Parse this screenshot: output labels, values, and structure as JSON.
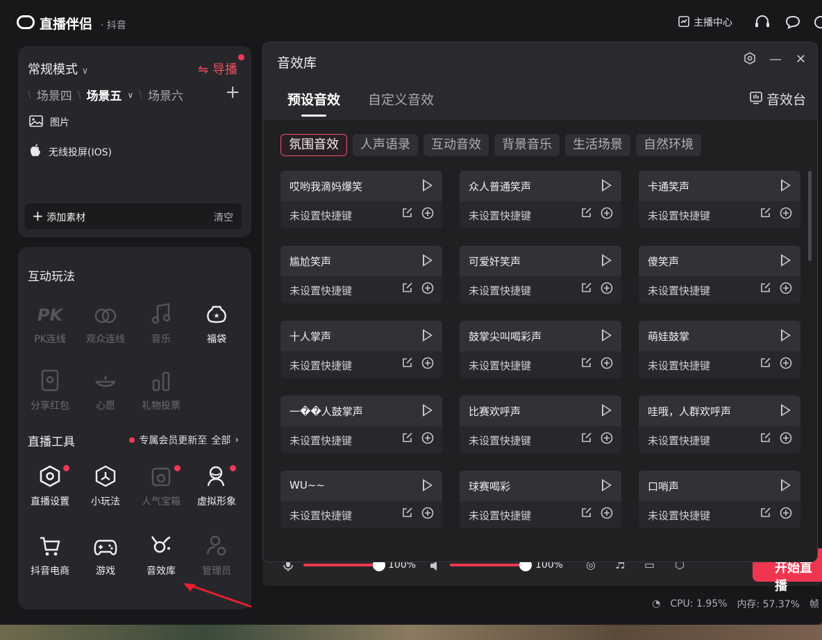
{
  "titlebar": {
    "app_name": "直播伴侣",
    "platform": "· 抖音",
    "anchor_center": "主播中心",
    "icons": [
      "chart-icon",
      "headset-icon",
      "chat-icon",
      "help-icon"
    ]
  },
  "left_top": {
    "mode": "常规模式",
    "guide": "导播",
    "scenes": [
      "场景四",
      "场景五",
      "场景六"
    ],
    "sources": [
      {
        "icon": "image-icon",
        "label": "图片"
      },
      {
        "icon": "apple-icon",
        "label": "无线投屏(IOS)"
      }
    ],
    "add_material": "添加素材",
    "clear": "清空"
  },
  "interactive": {
    "title": "互动玩法",
    "items": [
      {
        "icon": "pk-icon",
        "label": "PK连线",
        "dim": true
      },
      {
        "icon": "audience-link-icon",
        "label": "观众连线",
        "dim": true
      },
      {
        "icon": "music-icon",
        "label": "音乐",
        "dim": true
      },
      {
        "icon": "lucky-bag-icon",
        "label": "福袋",
        "dim": false
      },
      {
        "icon": "red-packet-icon",
        "label": "分享红包",
        "dim": true
      },
      {
        "icon": "wish-icon",
        "label": "心愿",
        "dim": true
      },
      {
        "icon": "gift-vote-icon",
        "label": "礼物投票",
        "dim": true
      }
    ]
  },
  "tools": {
    "title": "直播工具",
    "member_note": "专属会员更新至",
    "all": "全部",
    "items": [
      {
        "icon": "settings-hex-icon",
        "label": "直播设置",
        "dim": false,
        "dot": true
      },
      {
        "icon": "mini-game-icon",
        "label": "小玩法",
        "dim": false,
        "dot": false
      },
      {
        "icon": "treasure-box-icon",
        "label": "人气宝箱",
        "dim": true,
        "dot": true
      },
      {
        "icon": "avatar-icon",
        "label": "虚拟形象",
        "dim": false,
        "dot": true
      },
      {
        "icon": "cart-icon",
        "label": "抖音电商",
        "dim": false,
        "dot": false
      },
      {
        "icon": "gamepad-icon",
        "label": "游戏",
        "dim": false,
        "dot": false
      },
      {
        "icon": "sound-fx-icon",
        "label": "音效库",
        "dim": false,
        "dot": false
      },
      {
        "icon": "admin-icon",
        "label": "管理员",
        "dim": true,
        "dot": false
      }
    ]
  },
  "controls": {
    "mic_volume": "100%",
    "speaker_volume": "100%",
    "start_live": "开始直播"
  },
  "status": {
    "cpu": "CPU: 1.95%",
    "mem": "内存: 57.37%",
    "fps": "帧"
  },
  "dialog": {
    "title": "音效库",
    "tabs": [
      "预设音效",
      "自定义音效"
    ],
    "station": "音效台",
    "categories": [
      "氛围音效",
      "人声语录",
      "互动音效",
      "背景音乐",
      "生活场景",
      "自然环境"
    ],
    "hotkey_text": "未设置快捷键",
    "sounds": [
      "哎哟我滴妈爆笑",
      "众人普通笑声",
      "卡通笑声",
      "尴尬笑声",
      "可爱奸笑声",
      "傻笑声",
      "十人掌声",
      "鼓掌尖叫喝彩声",
      "萌娃鼓掌",
      "一��人鼓掌声",
      "比赛欢呼声",
      "哇哦，人群欢呼声",
      "WU~~",
      "球赛喝彩",
      "口哨声"
    ]
  }
}
